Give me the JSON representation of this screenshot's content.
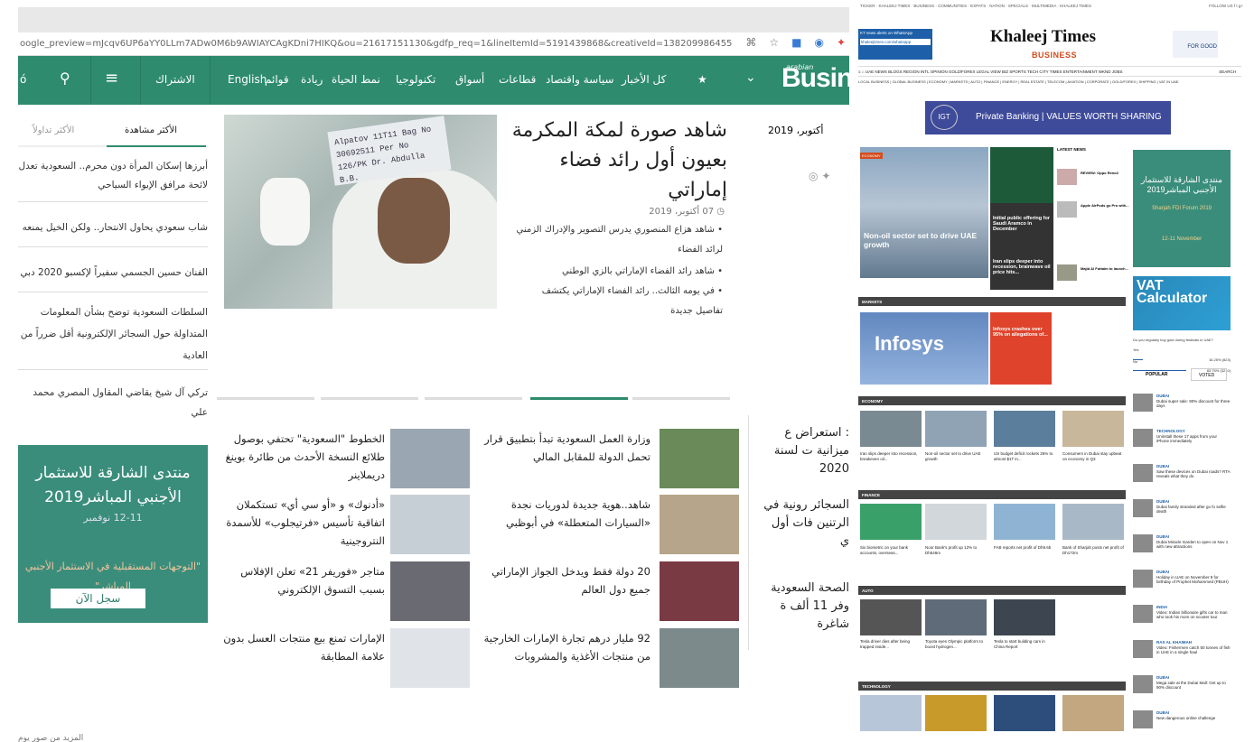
{
  "left": {
    "url": "oogle_preview=mJcqv6UP6aYY0LLm7ADw0M6b9AWIAYCAgKDni7HIKQ&ou=21617151130&gdfp_req=1&lineItemId=5191439868&creativeId=138209986455",
    "nav": {
      "brand": "Business",
      "brand_small": "arabian",
      "items": [
        "كل الأخبار",
        "سياسة واقتصاد",
        "قطاعات",
        "أسواق",
        "تكنولوجيا",
        "نمط الحياة",
        "ريادة",
        "قوائم",
        "English",
        "اشتراك"
      ],
      "subscribe": "الاشتراك"
    },
    "tabs": {
      "most_viewed": "الأكثر مشاهدة",
      "most_shared": "الأكثر تداولاً"
    },
    "list": [
      "أبرزها إسكان المرأة دون محرم.. السعودية تعدل لائحة مرافق الإيواء السياحي",
      "شاب سعودي يحاول الانتحار.. ولكن الخيل يمنعه",
      "الفنان حسين الجسمي سفيراً لإكسبو 2020 دبي",
      "السلطات السعودية توضح بشأن المعلومات المتداولة حول السجائر الإلكترونية أقل ضرراً من العادية",
      "تركي آل شيخ يقاضي المقاول المصري محمد علي"
    ],
    "promo": {
      "title": "منتدى الشارقة للاستثمار الأجنبي المباشر2019",
      "date": "12-11 نوفمبر",
      "sub": "\"التوجهات المستقبلية في الاستثمار الأجنبي المباشر\"",
      "button": "سجل الآن"
    },
    "hero": {
      "title": "شاهد صورة لمكة المكرمة بعيون أول رائد فضاء إماراتي",
      "date": "07 أكتوبر، 2019",
      "bullets": [
        "شاهد هزاع المنصوري يدرس التصوير والإدراك الزمني لرائد الفضاء",
        "شاهد رائد الفضاء الإماراتي بالزي الوطني",
        "في يومه الثالث.. رائد الفضاء الإماراتي يكتشف تفاصيل جديدة"
      ],
      "tag_text": "Alpatov 11T11 Bag No 30692511 Per No 126/PK Dr. Abdulla B.B.",
      "date_right": "أكتوبر، 2019"
    },
    "grid": [
      {
        "title": "وزارة العمل السعودية تبدأ بتطبيق قرار تحمل الدولة للمقابل المالي",
        "color": "#6a8a5a"
      },
      {
        "title": "الخطوط \"السعودية\" تحتفي بوصول طلائع النسخة الأحدث من طائرة بوينغ دريملاينر",
        "color": "#9aa7b2"
      },
      {
        "title": "شاهد..هوية جديدة لدوريات نجدة «السيارات المتعطلة» في أبوظبي",
        "color": "#b6a58a"
      },
      {
        "title": "«أدنوك» و «أو سي أي» تستكملان اتفاقية تأسيس «فرتيجلوب» للأسمدة النتروجينية",
        "color": "#c7cfd6"
      },
      {
        "title": "20 دولة فقط ويدخل الجواز الإماراتي جميع دول العالم",
        "color": "#7a3a44"
      },
      {
        "title": "متاجر «فوريفر 21» تعلن الإفلاس بسبب التسوق الإلكتروني",
        "color": "#6a6a72"
      },
      {
        "title": "92 مليار درهم تجارة الإمارات الخارجية من منتجات الأغذية والمشروبات",
        "color": "#7c8a8c"
      },
      {
        "title": "الإمارات تمنع بيع منتجات العسل بدون علامة المطابقة",
        "color": "#e0e4e8"
      }
    ],
    "right_col": [
      ": استعراض ع ميزانية ت لسنة 2020",
      "السجائر رونية في الرتنين فات أول ي",
      "الصحة السعودية وفر 11 ألف ة شاغرة"
    ],
    "bottom": "المزيد من صور يوم"
  },
  "right": {
    "topbar": "TICKER · KHALEEJ TIMES · BUSINESS · COMMUNITIES · EXPATS · NATION · SPECIALS · MULTIMEDIA · KHALEEJ TIMES",
    "follow": "FOLLOW US  f  t  g+",
    "whatsapp": "KT news alerts on WhatsApp",
    "whatsapp_num": "khaleejtimes.com/whatsapp",
    "logo": "Khaleej Times",
    "business": "BUSINESS",
    "kt_good": "FOR GOOD",
    "nav": "UAE  NEWS  BLOGS  REGION  INTL  OPINION  GOLD/FOREX  LEGAL VIEW  BIZ  SPORTS  TECH  CITY TIMES  ENTERTAINMENT  WKND  JOBS",
    "search": "SEARCH",
    "subnav": "LOCAL BUSINESS | GLOBAL BUSINESS | ECONOMY | MARKETS | AUTO | FINANCE | ENERGY | REAL ESTATE | TELECOM | AVIATION | CORPORATE | GOLD/FOREX | SHIPPING | VAT IN UAE",
    "ad": "Private Banking  |  VALUES WORTH SHARING",
    "ad_logo": "IGT",
    "hero_tag": "ECONOMY",
    "hero_title": "Non-oil sector set to drive UAE growth",
    "mid1": "Initial public offering for Saudi Aramco in December",
    "mid2": "Iran slips deeper into recession, brainwave oil price hits...",
    "latest_title": "LATEST NEWS",
    "latest": [
      "REVIEW: Oppo Reno2",
      "Apple AirPods go Pro with...",
      "Majid Al Futtaim to launch..."
    ],
    "sections": {
      "markets": "MARKETS",
      "economy": "ECONOMY",
      "finance": "FINANCE",
      "auto": "AUTO",
      "technology": "TECHNOLOGY"
    },
    "market_title": "Infosys crashes over 95% on allegations of...",
    "market_word": "Infosys",
    "economy_caps": [
      "Iran slips deeper into recession, breakeven oil...",
      "Non-oil sector set to drive UAE growth",
      "US budget deficit rockets 26% to almost $1T in...",
      "Consumers in Dubai stay upbeat on economy in Q3"
    ],
    "finance_caps": [
      "Six biometric on your bank accounts, overseas...",
      "Noor Bank's profit up 12% to Dh546m",
      "FAB reports net profit of Dh9.6b",
      "Bank of Sharjah posts net profit of Dh172m"
    ],
    "auto_caps": [
      "Tesla driver dies after being trapped inside...",
      "Toyota eyes Olympic platform to boost hydrogen...",
      "Tesla to start building cars in China Report"
    ],
    "fdi": {
      "title": "منتدى الشارقة للاستثمار الأجنبي المباشر2019",
      "sub": "Sharjah FDI Forum 2019",
      "date": "12-11 November"
    },
    "vat": "VAT Calculator",
    "poll_q": "Do you regularly buy gold during festivals in UAE?",
    "poll": [
      {
        "label": "Yes",
        "pct": "16.25%",
        "n": "(823)"
      },
      {
        "label": "No",
        "pct": "83.75%",
        "n": "(3210)"
      }
    ],
    "tabs": [
      "POPULAR",
      "VOTED"
    ],
    "popular": [
      {
        "k": "DUBAI",
        "t": "Dubai super sale: 90% discount for three days"
      },
      {
        "k": "TECHNOLOGY",
        "t": "Uninstall these 17 apps from your iPhone immediately"
      },
      {
        "k": "DUBAI",
        "t": "Saw these devices on Dubai roads? RTA reveals what they do"
      },
      {
        "k": "DUBAI",
        "t": "Dubai family stranded after go fo selfie death"
      },
      {
        "k": "DUBAI",
        "t": "Dubai Miracle Garden to open on Nov 1 with new attractions"
      },
      {
        "k": "DUBAI",
        "t": "Holiday in UAE on November 9 for birthday of Prophet Mohammed (PBUH)"
      },
      {
        "k": "INDIA",
        "t": "Video: Indian billionaire gifts car to man who took his mom on scooter tour"
      },
      {
        "k": "RAS AL KHAIMAH",
        "t": "Video: Fishermen catch 50 tonnes of fish in UAE in a single haul"
      },
      {
        "k": "DUBAI",
        "t": "Mega sale at the Dubai Mall: Get up to 90% discount"
      },
      {
        "k": "DUBAI",
        "t": "New dangerous online challenge"
      }
    ]
  }
}
